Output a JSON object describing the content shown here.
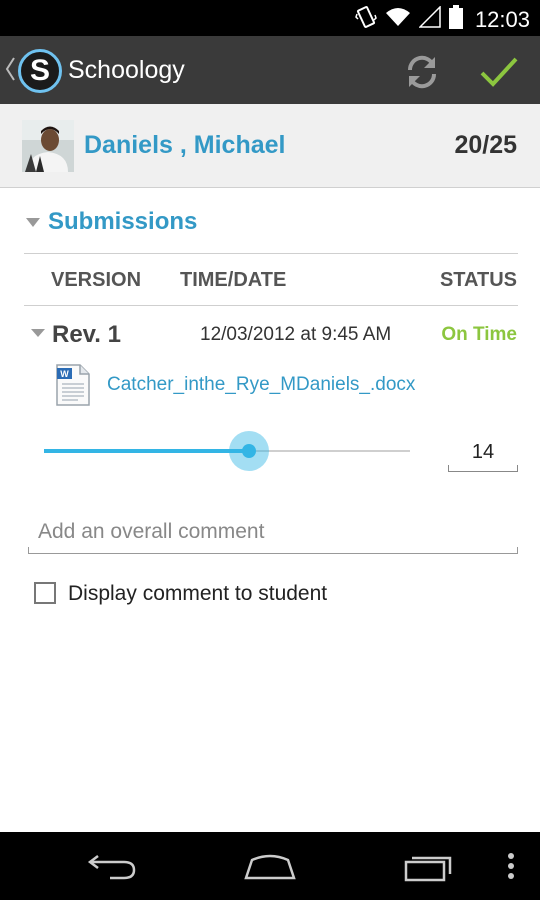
{
  "status_bar": {
    "time": "12:03",
    "icons": [
      "vibrate-icon",
      "wifi-icon",
      "signal-icon",
      "battery-icon"
    ]
  },
  "action_bar": {
    "logo_letter": "S",
    "app_title": "Schoology",
    "actions": [
      "refresh-icon",
      "checkmark-icon"
    ],
    "colors": {
      "background": "#3a3a3a",
      "logo_ring": "#6fc2f0",
      "check": "#8cc63f"
    }
  },
  "student": {
    "name": "Daniels , Michael",
    "score": "20/25"
  },
  "submissions": {
    "section_title": "Submissions",
    "columns": {
      "version": "VERSION",
      "time_date": "TIME/DATE",
      "status": "STATUS"
    },
    "revision": {
      "label": "Rev. 1",
      "date": "12/03/2012 at 9:45 AM",
      "status": "On Time",
      "file_name": "Catcher_inthe_Rye_MDaniels_.docx"
    }
  },
  "grading": {
    "slider_value_fraction": 0.56,
    "score_value": "14"
  },
  "comment": {
    "placeholder": "Add an overall comment",
    "value": "",
    "display_to_student_label": "Display comment to student",
    "display_to_student_checked": false
  },
  "nav_bar": {
    "buttons": [
      "back-icon",
      "home-icon",
      "recent-apps-icon",
      "overflow-menu-icon"
    ]
  },
  "theme": {
    "accent": "#3399c6",
    "status_ok": "#8cc63f",
    "slider": "#33b5e5"
  }
}
